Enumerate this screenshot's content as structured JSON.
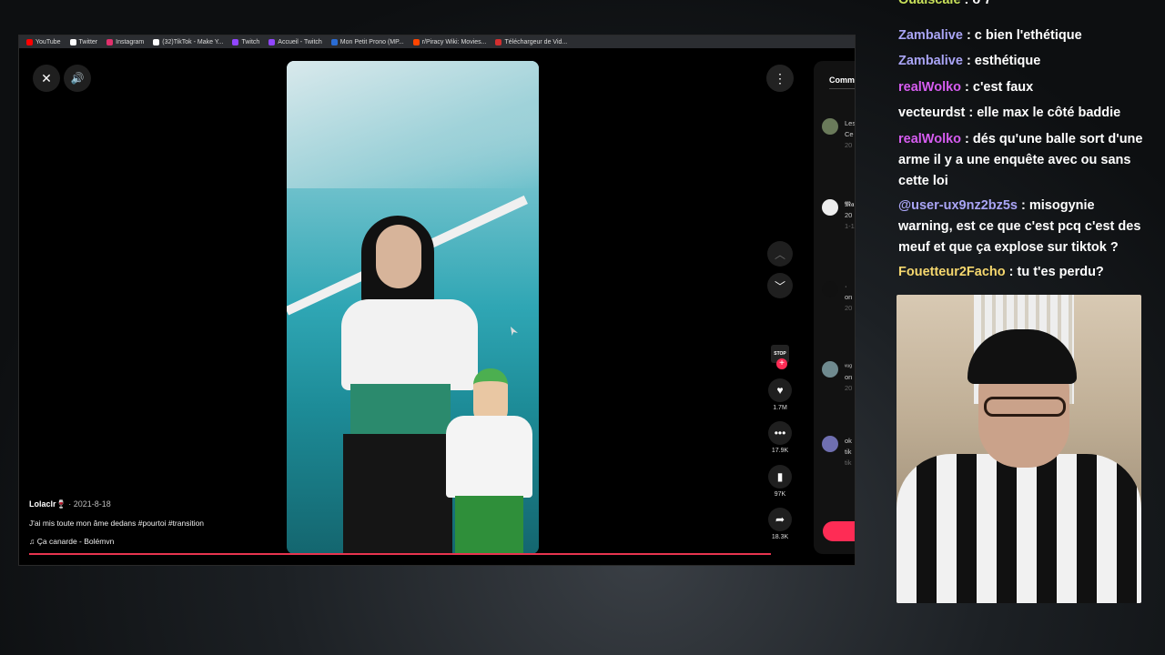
{
  "bookmarks": [
    {
      "label": "YouTube",
      "color": "#ff0000"
    },
    {
      "label": "Twitter",
      "color": "#ffffff"
    },
    {
      "label": "Instagram",
      "color": "#e1306c"
    },
    {
      "label": "(32)TikTok - Make Y...",
      "color": "#ffffff"
    },
    {
      "label": "Twitch",
      "color": "#9146ff"
    },
    {
      "label": "Accueil - Twitch",
      "color": "#9146ff"
    },
    {
      "label": "Mon Petit Prono (MP...",
      "color": "#2a6cd4"
    },
    {
      "label": "r/Piracy Wiki: Movies...",
      "color": "#ff4500"
    },
    {
      "label": "Téléchargeur de Vid...",
      "color": "#d32f2f"
    }
  ],
  "player": {
    "close_icon": "✕",
    "volume_icon": "🔊",
    "more_icon": "⋮",
    "nav_up_icon": "︿",
    "nav_down_icon": "﹀"
  },
  "video": {
    "author": "Lolaclr🍷",
    "date": " · 2021-8-18",
    "caption": "J'ai mis toute mon âme dedans #pourtoi #transition",
    "music": "♫  Ça canarde - Bolémvn"
  },
  "actions": {
    "avatar_text": "STOP",
    "follow": "+",
    "likes": "1.7M",
    "comments": "17.9K",
    "saves": "97K",
    "shares": "18.3K"
  },
  "comments_panel": {
    "title": "Comm",
    "items": [
      {
        "line1": "Les",
        "line2": "Ce",
        "line3": "20"
      },
      {
        "line1": "𝕸𝖆",
        "line2": "20",
        "line3": "1-1"
      },
      {
        "line1": "·",
        "line2": "on",
        "line3": "20"
      },
      {
        "line1": "ᵛᵘᵍ",
        "line2": "on",
        "line3": "20"
      },
      {
        "line1": "ok",
        "line2": "tik",
        "line3": "tik"
      }
    ]
  },
  "chat": {
    "top_partial": {
      "user": "Oualscale",
      "text": " : ö 7"
    },
    "messages": [
      {
        "user": "Zambalive",
        "color": "#a9a4f5",
        "text": " : c bien l'ethétique"
      },
      {
        "user": "Zambalive",
        "color": "#a9a4f5",
        "text": " : esthétique"
      },
      {
        "user": "realWolko",
        "color": "#d65cf0",
        "text": " : c'est faux"
      },
      {
        "user": "vecteurdst",
        "color": "#ffffff",
        "text": " : elle max le côté baddie"
      },
      {
        "user": "realWolko",
        "color": "#d65cf0",
        "text": " : dés qu'une balle sort d'une arme il y a une enquête avec ou sans cette loi"
      },
      {
        "user": "@user-ux9nz2bz5s",
        "color": "#a9a4f5",
        "text": " : misogynie warning, est ce que c'est pcq c'est des meuf et que ça explose sur tiktok ?"
      },
      {
        "user": "Fouetteur2Facho",
        "color": "#f5d76e",
        "text": " : tu t'es perdu?"
      }
    ]
  }
}
